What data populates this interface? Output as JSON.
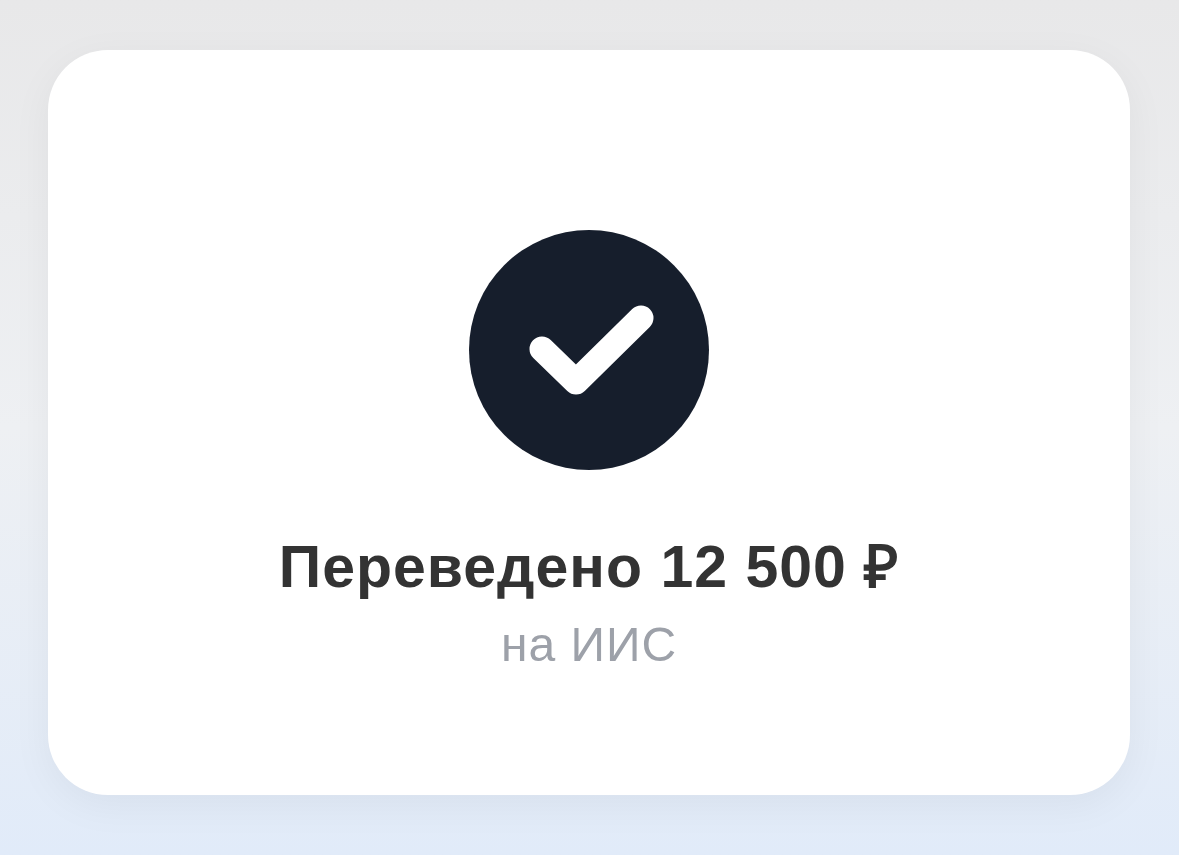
{
  "notification": {
    "title": "Переведено 12 500 ₽",
    "subtitle": "на ИИС"
  }
}
